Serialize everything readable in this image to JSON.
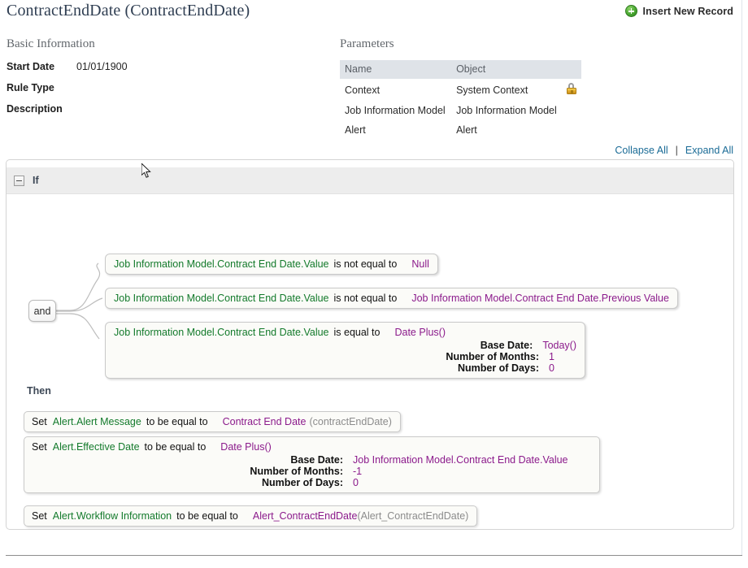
{
  "header": {
    "title": "ContractEndDate (ContractEndDate)",
    "insert_new_record_label": "Insert New Record",
    "insert_icon": "plus-circle-icon"
  },
  "basic_information": {
    "heading": "Basic Information",
    "rows": [
      {
        "label": "Start Date",
        "value": "01/01/1900"
      },
      {
        "label": "Rule Type",
        "value": ""
      },
      {
        "label": "Description",
        "value": ""
      }
    ]
  },
  "parameters": {
    "heading": "Parameters",
    "columns": [
      "Name",
      "Object",
      ""
    ],
    "rows": [
      {
        "name": "Context",
        "object": "System Context",
        "icon": "lock-icon"
      },
      {
        "name": "Job Information Model",
        "object": "Job Information Model",
        "icon": ""
      },
      {
        "name": "Alert",
        "object": "Alert",
        "icon": ""
      }
    ]
  },
  "toolbar": {
    "collapse_all": "Collapse All",
    "separator": "|",
    "expand_all": "Expand All"
  },
  "rule": {
    "if_label": "If",
    "operator_node": "and",
    "conditions": [
      {
        "left": "Job Information Model.Contract End Date.Value",
        "operator": "is not equal to",
        "right": "Null",
        "args": []
      },
      {
        "left": "Job Information Model.Contract End Date.Value",
        "operator": "is not equal to",
        "right": "Job Information Model.Contract End Date.Previous Value",
        "args": []
      },
      {
        "left": "Job Information Model.Contract End Date.Value",
        "operator": "is equal to",
        "right": "Date Plus()",
        "args": [
          {
            "label": "Base Date:",
            "value": "Today()"
          },
          {
            "label": "Number of Months:",
            "value": "1"
          },
          {
            "label": "Number of Days:",
            "value": "0"
          }
        ]
      }
    ],
    "then_label": "Then",
    "actions": [
      {
        "verb": "Set",
        "target": "Alert.Alert Message",
        "operator": "to be equal to",
        "value": "Contract End Date",
        "value_suffix": "(contractEndDate)",
        "args": []
      },
      {
        "verb": "Set",
        "target": "Alert.Effective Date",
        "operator": "to be equal to",
        "value": "Date Plus()",
        "value_suffix": "",
        "args": [
          {
            "label": "Base Date:",
            "value": "Job Information Model.Contract End Date.Value"
          },
          {
            "label": "Number of Months:",
            "value": "-1"
          },
          {
            "label": "Number of Days:",
            "value": "0"
          }
        ]
      },
      {
        "verb": "Set",
        "target": "Alert.Workflow Information",
        "operator": "to be equal to",
        "value": "Alert_ContractEndDate",
        "value_suffix": "(Alert_ContractEndDate)",
        "args": []
      }
    ]
  },
  "colors": {
    "field_green": "#137a2b",
    "value_purple": "#8b1a8b",
    "link_blue": "#1a6b96",
    "heading_gray": "#62676c",
    "panel_header_gray": "#ededed"
  }
}
